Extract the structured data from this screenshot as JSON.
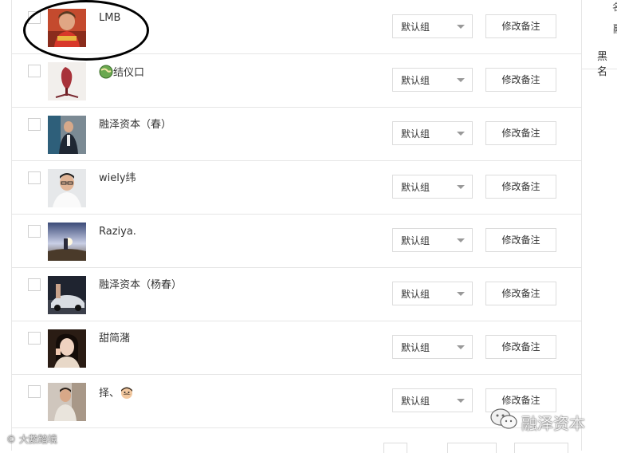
{
  "contacts": [
    {
      "name": "LMB",
      "group": "默认组",
      "action": "修改备注",
      "avatar": "avatar-red-shirt"
    },
    {
      "name": "结仪口",
      "group": "默认组",
      "action": "修改备注",
      "avatar": "avatar-sculpture",
      "emoji": "globe-emoji"
    },
    {
      "name": "融泽资本（春）",
      "group": "默认组",
      "action": "修改备注",
      "avatar": "avatar-man-suit"
    },
    {
      "name": "wiely纬",
      "group": "默认组",
      "action": "修改备注",
      "avatar": "avatar-man-glasses"
    },
    {
      "name": "Raziya.",
      "group": "默认组",
      "action": "修改备注",
      "avatar": "avatar-sunset"
    },
    {
      "name": "融泽资本（杨春）",
      "group": "默认组",
      "action": "修改备注",
      "avatar": "avatar-car"
    },
    {
      "name": "甜简潴",
      "group": "默认组",
      "action": "修改备注",
      "avatar": "avatar-girl"
    },
    {
      "name": "择、",
      "group": "默认组",
      "action": "修改备注",
      "avatar": "avatar-man-room",
      "emoji": "mustache-face-emoji"
    }
  ],
  "right_panel": {
    "item_1": "名",
    "item_2": "融",
    "item_3": "黑名"
  },
  "watermarks": {
    "left": "大數踏境",
    "right": "融泽资本"
  }
}
